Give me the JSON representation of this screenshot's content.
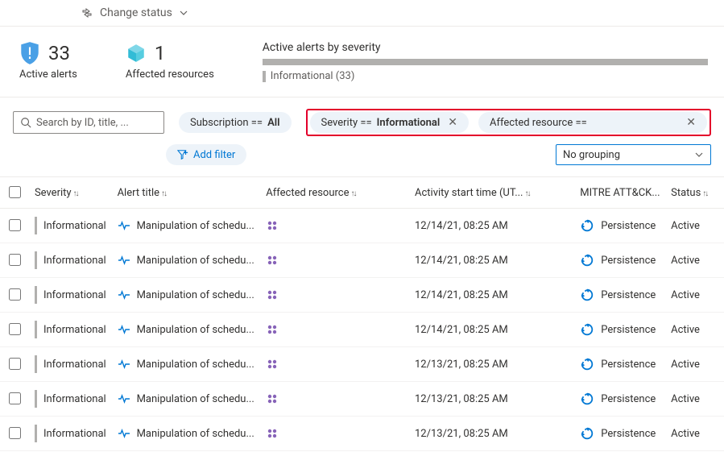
{
  "toolbar": {
    "change_status": "Change status"
  },
  "summary": {
    "active_alerts_count": "33",
    "active_alerts_label": "Active alerts",
    "affected_resources_count": "1",
    "affected_resources_label": "Affected resources"
  },
  "severity_chart": {
    "title": "Active alerts by severity",
    "legend_label": "Informational (33)"
  },
  "search": {
    "placeholder": "Search by ID, title, ..."
  },
  "filters": {
    "subscription_prefix": "Subscription == ",
    "subscription_value": "All",
    "severity_prefix": "Severity == ",
    "severity_value": "Informational",
    "affected_resource_prefix": "Affected resource ==",
    "add_filter": "Add filter"
  },
  "grouping": {
    "value": "No grouping"
  },
  "columns": {
    "severity": "Severity",
    "title": "Alert title",
    "resource": "Affected resource",
    "start_time": "Activity start time (UT...",
    "mitre": "MITRE ATT&CK...",
    "status": "Status"
  },
  "rows": [
    {
      "severity": "Informational",
      "title": "Manipulation of schedu...",
      "time": "12/14/21, 08:25 AM",
      "mitre": "Persistence",
      "status": "Active"
    },
    {
      "severity": "Informational",
      "title": "Manipulation of schedu...",
      "time": "12/14/21, 08:25 AM",
      "mitre": "Persistence",
      "status": "Active"
    },
    {
      "severity": "Informational",
      "title": "Manipulation of schedu...",
      "time": "12/14/21, 08:25 AM",
      "mitre": "Persistence",
      "status": "Active"
    },
    {
      "severity": "Informational",
      "title": "Manipulation of schedu...",
      "time": "12/14/21, 08:25 AM",
      "mitre": "Persistence",
      "status": "Active"
    },
    {
      "severity": "Informational",
      "title": "Manipulation of schedu...",
      "time": "12/13/21, 08:25 AM",
      "mitre": "Persistence",
      "status": "Active"
    },
    {
      "severity": "Informational",
      "title": "Manipulation of schedu...",
      "time": "12/13/21, 08:25 AM",
      "mitre": "Persistence",
      "status": "Active"
    },
    {
      "severity": "Informational",
      "title": "Manipulation of schedu...",
      "time": "12/13/21, 08:25 AM",
      "mitre": "Persistence",
      "status": "Active"
    }
  ]
}
